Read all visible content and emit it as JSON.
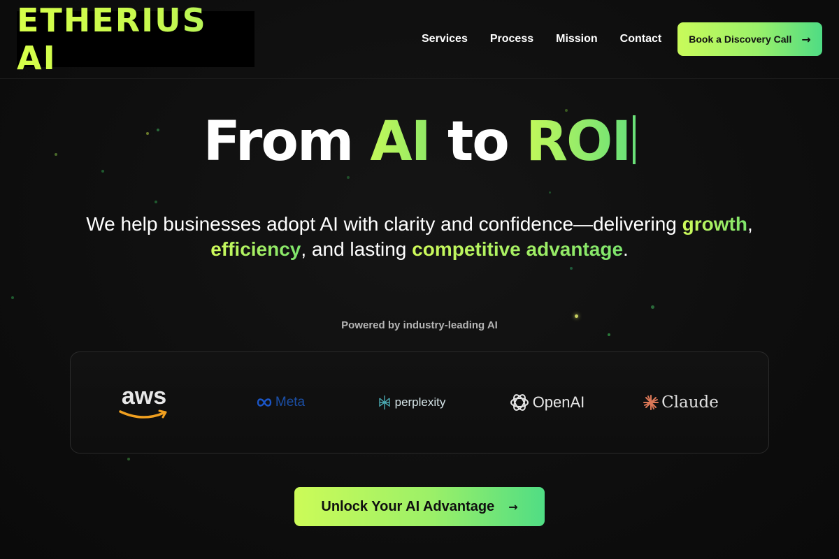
{
  "header": {
    "logo_text": "ETHERIUS AI",
    "nav": [
      "Services",
      "Process",
      "Mission",
      "Contact"
    ],
    "cta_label": "Book a Discovery Call",
    "cta_arrow": "→"
  },
  "hero": {
    "title_part1": "From ",
    "title_ai": "AI",
    "title_part2": " to ",
    "title_roi": "ROI",
    "subtitle_1": "We help businesses adopt AI with clarity and confidence—delivering ",
    "subtitle_growth": "growth",
    "subtitle_2": ",",
    "subtitle_efficiency": "efficiency",
    "subtitle_3": ", and lasting ",
    "subtitle_advantage": "competitive advantage",
    "subtitle_4": "."
  },
  "partners": {
    "heading": "Powered by industry-leading AI",
    "brands": [
      "aws",
      "Meta",
      "perplexity",
      "OpenAI",
      "Claude"
    ]
  },
  "cta_main": {
    "label": "Unlock Your AI Advantage",
    "arrow": "→"
  },
  "colors": {
    "accent_lime": "#c9fb5a",
    "accent_green": "#4fdc84",
    "background": "#0f0f0f"
  }
}
